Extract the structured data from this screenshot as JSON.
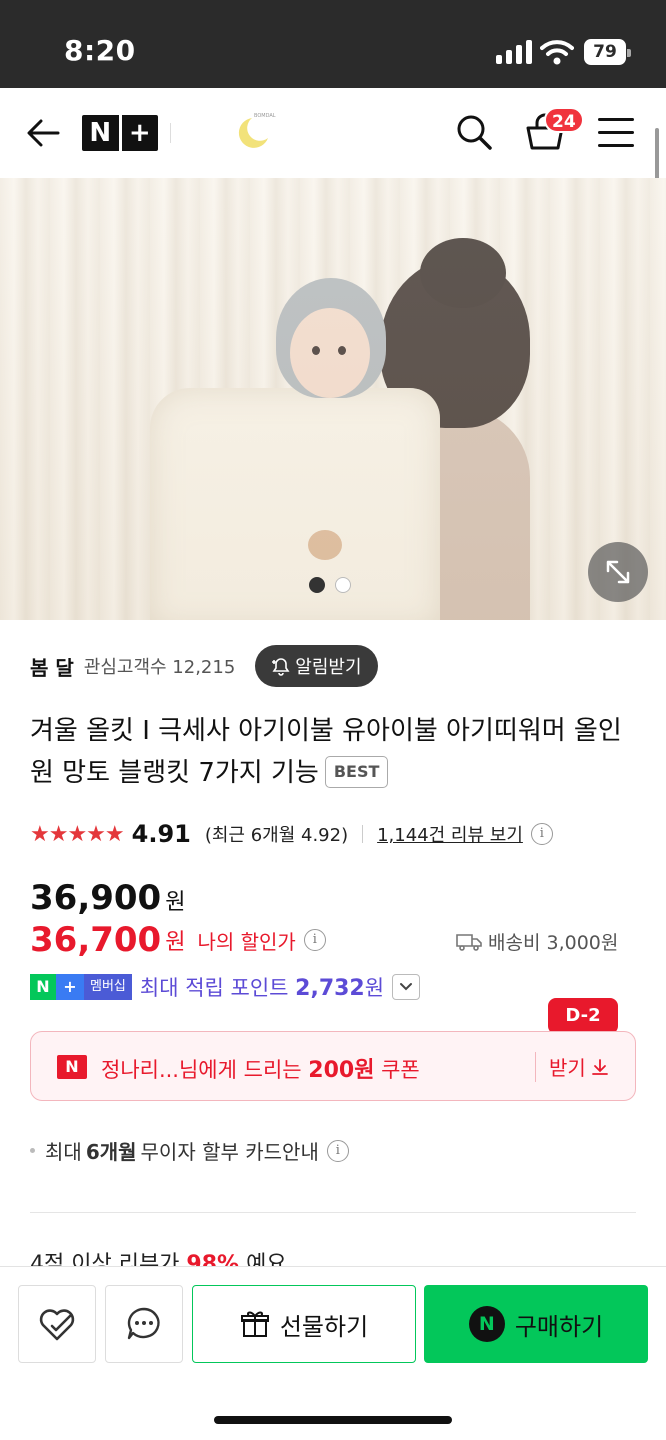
{
  "status_bar": {
    "time": "8:20",
    "battery": "79"
  },
  "header": {
    "logo_left": "N",
    "logo_right": "+",
    "cart_count": "24",
    "brand_logo_text": "BOMDAL"
  },
  "hero": {
    "slide_count": 2,
    "active_slide": 1
  },
  "store": {
    "name": "봄 달",
    "fans": "관심고객수 12,215",
    "alarm_label": "알림받기"
  },
  "product": {
    "title": "겨울 올킷 I 극세사 아기이불 유아이불 아기띠워머 올인원 망토 블랭킷 7가지 기능",
    "badge": "BEST"
  },
  "rating": {
    "stars": "★★★★★",
    "score": "4.91",
    "recent": "(최근 6개월 4.92)",
    "reviews": "1,144건 리뷰 보기",
    "info": "i"
  },
  "price": {
    "original": "36,900",
    "original_unit": "원",
    "my_price": "36,700",
    "my_price_unit": "원",
    "my_price_label": "나의 할인가",
    "shipping": "배송비 3,000원"
  },
  "membership": {
    "badge_n": "N",
    "badge_plus": "+",
    "badge_text": "멤버십",
    "points_prefix": "최대 적립 포인트 ",
    "points_value": "2,732",
    "points_unit": "원"
  },
  "coupon": {
    "d_badge": "D-2",
    "logo": "N",
    "text_prefix": "정나리...님에게 드리는 ",
    "amount": "200원",
    "text_suffix": " 쿠폰",
    "get_label": "받기"
  },
  "installment": {
    "prefix": "최대",
    "months": "6개월",
    "suffix": "무이자 할부 카드안내"
  },
  "review_peek": {
    "prefix": "4점 이상 리뷰가 ",
    "percent": "98%",
    "suffix": " 예요"
  },
  "bottom_bar": {
    "gift_label": "선물하기",
    "buy_logo": "N",
    "buy_label": "구매하기"
  },
  "colors": {
    "naver_green": "#03c75a",
    "sale_red": "#e8192c",
    "point_purple": "#5c4bd6",
    "star_red": "#e4373b"
  }
}
